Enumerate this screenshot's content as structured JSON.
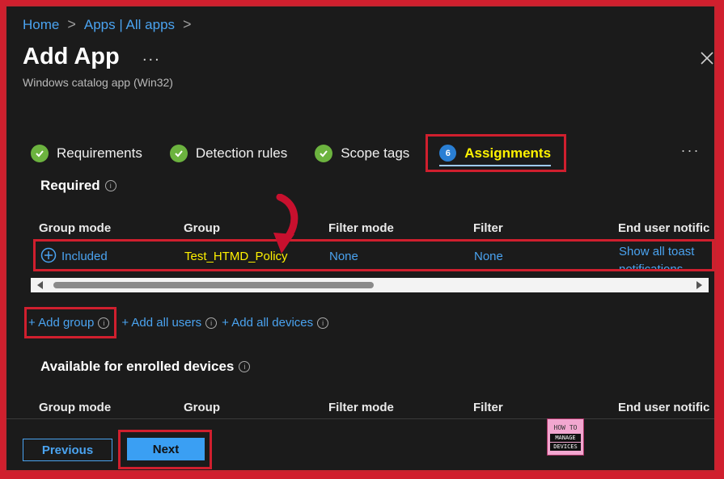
{
  "breadcrumb": {
    "items": [
      "Home",
      "Apps | All apps"
    ],
    "separator": ">"
  },
  "header": {
    "title": "Add App",
    "more": "...",
    "subtitle": "Windows catalog app (Win32)"
  },
  "tabs": [
    {
      "label": "Requirements",
      "status": "complete"
    },
    {
      "label": "Detection rules",
      "status": "complete"
    },
    {
      "label": "Scope tags",
      "status": "complete"
    },
    {
      "label": "Assignments",
      "step": "6",
      "status": "active"
    }
  ],
  "tabs_more": "...",
  "required": {
    "title": "Required",
    "columns": [
      "Group mode",
      "Group",
      "Filter mode",
      "Filter",
      "End user notific"
    ],
    "rows": [
      {
        "group_mode": "Included",
        "group": "Test_HTMD_Policy",
        "filter_mode": "None",
        "filter": "None",
        "notification": "Show all toast notifications"
      }
    ],
    "links": [
      {
        "label": "+ Add group",
        "info": "i"
      },
      {
        "label": "+ Add all users",
        "info": "i"
      },
      {
        "label": "+ Add all devices",
        "info": "i"
      }
    ]
  },
  "available": {
    "title": "Available for enrolled devices",
    "columns": [
      "Group mode",
      "Group",
      "Filter mode",
      "Filter",
      "End user notific"
    ]
  },
  "footer": {
    "previous_label": "Previous",
    "next_label": "Next"
  },
  "logo": {
    "line1": "HOW TO",
    "line2": "MANAGE",
    "line3": "DEVICES"
  },
  "colors": {
    "background": "#1b1b1b",
    "link": "#4aa3f0",
    "active_tab_text": "#fff200",
    "group_text": "#fff200",
    "check": "#6cb33f",
    "highlight_border": "#d01f2e",
    "primary_button": "#3a9ff3"
  }
}
